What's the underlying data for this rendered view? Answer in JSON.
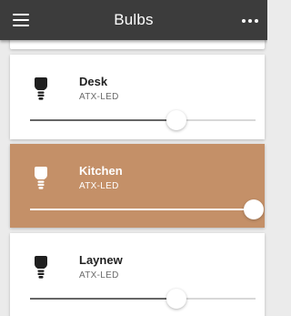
{
  "header": {
    "title": "Bulbs",
    "menu_icon": "hamburger-icon",
    "more_icon": "more-options-icon",
    "background": "#3c3c3c"
  },
  "bulbs": [
    {
      "name": "Desk",
      "type": "ATX-LED",
      "brightness": 0.65,
      "selected": false,
      "icon": "bulb-icon"
    },
    {
      "name": "Kitchen",
      "type": "ATX-LED",
      "brightness": 0.99,
      "selected": true,
      "icon": "bulb-icon",
      "highlight_color": "#c49068"
    },
    {
      "name": "Laynew",
      "type": "ATX-LED",
      "brightness": 0.65,
      "selected": false,
      "icon": "bulb-icon"
    }
  ]
}
